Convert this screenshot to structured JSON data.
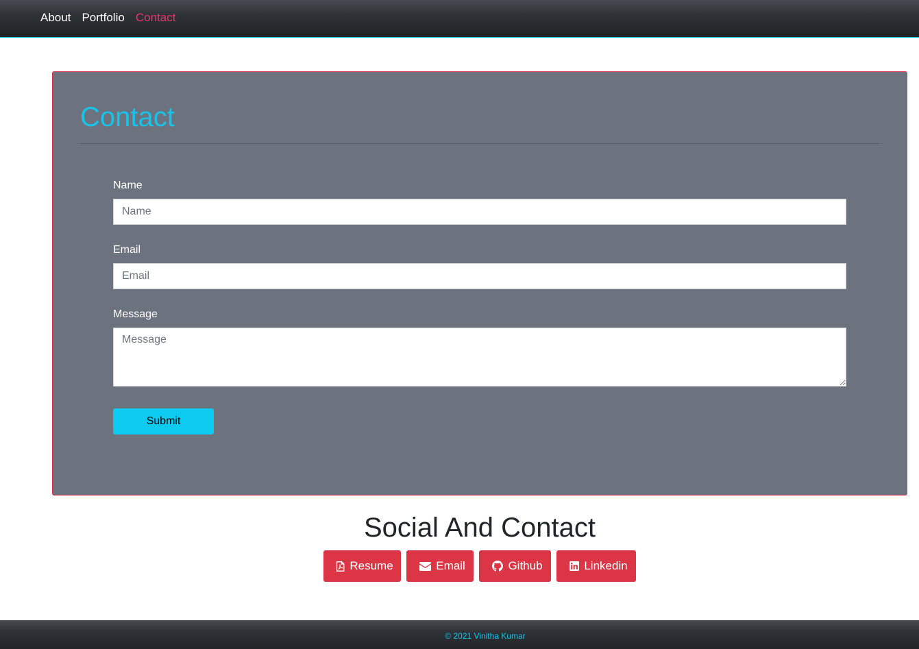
{
  "nav": {
    "links": [
      "About",
      "Portfolio",
      "Contact"
    ],
    "active": "Contact"
  },
  "contact": {
    "title": "Contact",
    "fields": {
      "name": {
        "label": "Name",
        "placeholder": "Name",
        "value": ""
      },
      "email": {
        "label": "Email",
        "placeholder": "Email",
        "value": ""
      },
      "message": {
        "label": "Message",
        "placeholder": "Message",
        "value": ""
      }
    },
    "submit_label": "Submit"
  },
  "social": {
    "title": "Social And Contact",
    "buttons": [
      {
        "label": "Resume",
        "icon": "file-pdf-icon"
      },
      {
        "label": "Email",
        "icon": "envelope-icon"
      },
      {
        "label": "Github",
        "icon": "github-icon"
      },
      {
        "label": "Linkedin",
        "icon": "linkedin-icon"
      }
    ]
  },
  "footer": {
    "text": "© 2021 Vinitha Kumar"
  },
  "colors": {
    "accent": "#17c3e8",
    "nav_active": "#e8336b",
    "card_bg": "#6c737e",
    "social_button": "#dc3545",
    "submit_button": "#0dcaf0"
  }
}
